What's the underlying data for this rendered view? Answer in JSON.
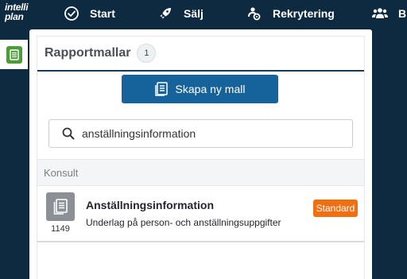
{
  "app": {
    "logo_line1": "intelli",
    "logo_line2": "plan"
  },
  "nav": {
    "items": [
      {
        "label": "Start",
        "icon": "check-circle-icon"
      },
      {
        "label": "Sälj",
        "icon": "rocket-icon"
      },
      {
        "label": "Rekrytering",
        "icon": "person-gear-icon"
      },
      {
        "label": "B",
        "icon": "users-icon"
      }
    ]
  },
  "sidebar": {
    "icon": "document-icon",
    "accent": "#4f9a3a"
  },
  "panel": {
    "title": "Rapportmallar",
    "count": "1",
    "create_button": "Skapa ny mall",
    "search": {
      "value": "anställningsinformation",
      "placeholder": ""
    },
    "group": "Konsult",
    "items": [
      {
        "number": "1149",
        "name": "Anställningsinformation",
        "description": "Underlag på person- och anställningsuppgifter",
        "badge": "Standard"
      }
    ]
  },
  "colors": {
    "nav_bg": "#0e2a40",
    "primary": "#15639a",
    "badge": "#f06f12"
  }
}
